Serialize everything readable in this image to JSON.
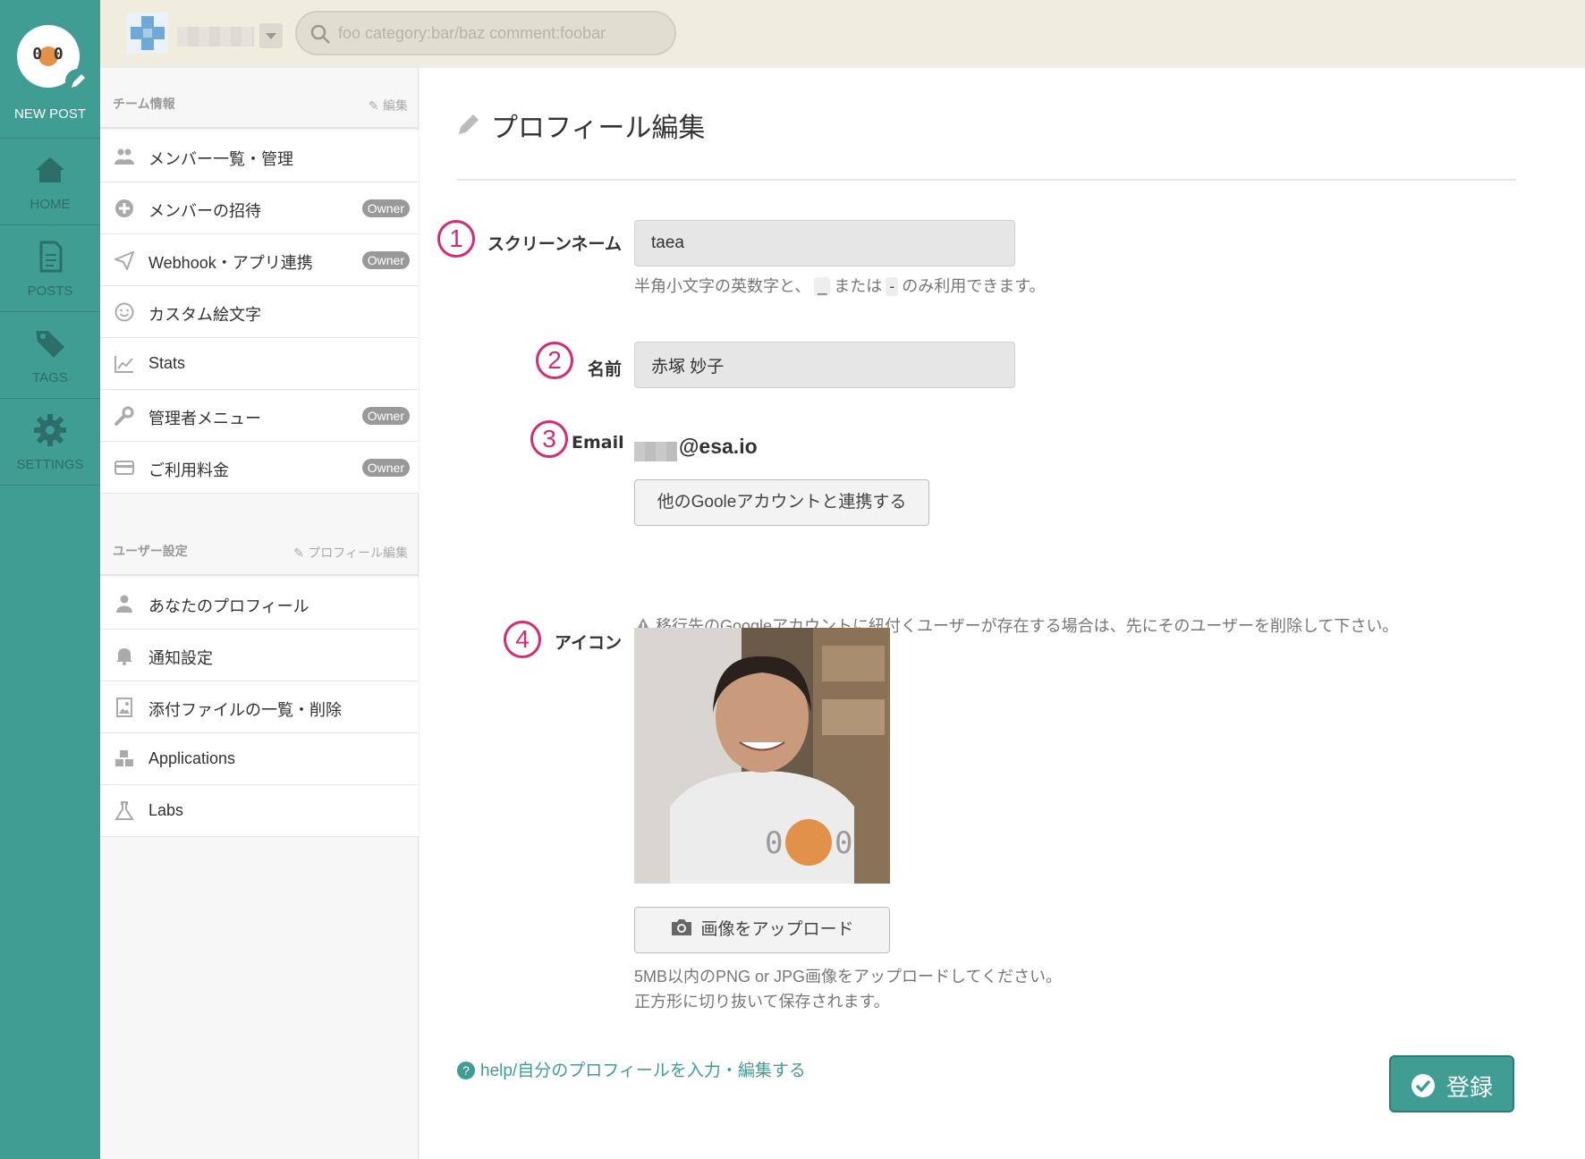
{
  "nav": {
    "new_post": "NEW POST",
    "items": [
      {
        "label": "HOME",
        "icon": "home-icon"
      },
      {
        "label": "POSTS",
        "icon": "posts-icon"
      },
      {
        "label": "TAGS",
        "icon": "tags-icon"
      },
      {
        "label": "SETTINGS",
        "icon": "gear-icon"
      }
    ],
    "logo_text": "0   0"
  },
  "topbar": {
    "search_placeholder": "foo category:bar/baz comment:foobar"
  },
  "sidebar": {
    "team_section": {
      "title": "チーム情報",
      "edit": "編集"
    },
    "team_items": [
      {
        "label": "メンバー一覧・管理",
        "owner": ""
      },
      {
        "label": "メンバーの招待",
        "owner": "Owner"
      },
      {
        "label": "Webhook・アプリ連携",
        "owner": "Owner"
      },
      {
        "label": "カスタム絵文字",
        "owner": ""
      },
      {
        "label": "Stats",
        "owner": ""
      },
      {
        "label": "管理者メニュー",
        "owner": "Owner"
      },
      {
        "label": "ご利用料金",
        "owner": "Owner"
      }
    ],
    "user_section": {
      "title": "ユーザー設定",
      "edit": "プロフィール編集"
    },
    "user_items": [
      {
        "label": "あなたのプロフィール"
      },
      {
        "label": "通知設定"
      },
      {
        "label": "添付ファイルの一覧・削除"
      },
      {
        "label": "Applications"
      },
      {
        "label": "Labs"
      }
    ]
  },
  "main": {
    "title": "プロフィール編集",
    "fields": {
      "screen_name": {
        "num": "1",
        "label": "スクリーンネーム",
        "value": "taea",
        "hint_a": "半角小文字の英数字と、",
        "hint_k1": "_",
        "hint_b": "または",
        "hint_k2": "-",
        "hint_c": "のみ利用できます。"
      },
      "name": {
        "num": "2",
        "label": "名前",
        "value": "赤塚 妙子"
      },
      "email": {
        "num": "3",
        "label": "Email",
        "value": "@esa.io",
        "link_button": "他のGooleアカウントと連携する",
        "warning": "移行先のGoogleアカウントに紐付くユーザーが存在する場合は、先にそのユーザーを削除して下さい。"
      },
      "icon": {
        "num": "4",
        "label": "アイコン",
        "upload_button": "画像をアップロード",
        "hint_line1": "5MB以内のPNG or JPG画像をアップロードしてください。",
        "hint_line2": "正方形に切り抜いて保存されます。"
      }
    },
    "help_link": "help/自分のプロフィールを入力・編集する",
    "submit": "登録"
  },
  "colors": {
    "accent": "#3f9d94",
    "badge": "#d62b74",
    "owner": "#999999"
  }
}
